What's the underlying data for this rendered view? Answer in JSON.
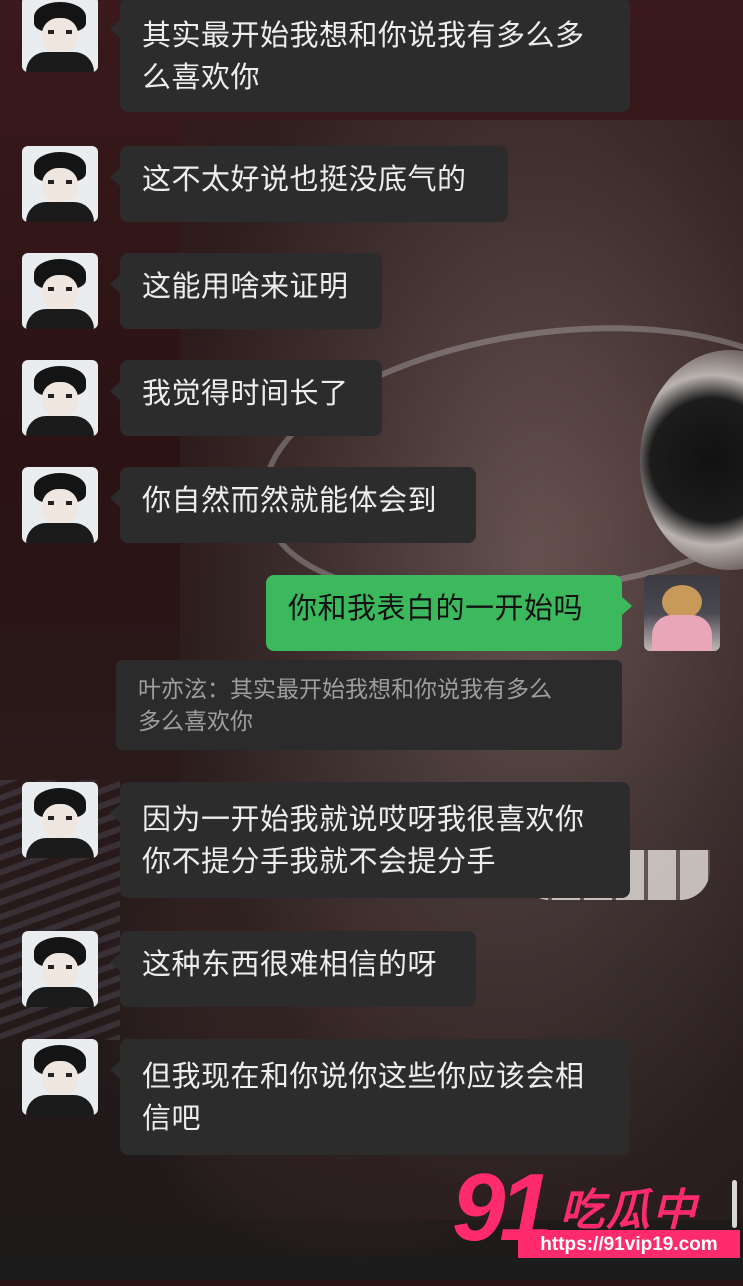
{
  "messages": [
    {
      "side": "left",
      "text": "其实最开始我想和你说我有多么多么喜欢你",
      "line1": "其实最开始我想和你说我有多么多",
      "line2": "么喜欢你"
    },
    {
      "side": "left",
      "text": "这不太好说也挺没底气的"
    },
    {
      "side": "left",
      "text": "这能用啥来证明"
    },
    {
      "side": "left",
      "text": "我觉得时间长了"
    },
    {
      "side": "left",
      "text": "你自然而然就能体会到"
    },
    {
      "side": "right",
      "text": "你和我表白的一开始吗"
    },
    {
      "side": "left",
      "text": "因为一开始我就说哎呀我很喜欢你你不提分手我就不会提分手",
      "line1": "因为一开始我就说哎呀我很喜欢你",
      "line2": "你不提分手我就不会提分手"
    },
    {
      "side": "left",
      "text": "这种东西很难相信的呀"
    },
    {
      "side": "left",
      "text": "但我现在和你说你这些你应该会相信吧",
      "line1": "但我现在和你说你这些你应该会相",
      "line2": "信吧"
    }
  ],
  "quote": {
    "line1": "叶亦泫：其实最开始我想和你说我有多么",
    "line2": "多么喜欢你"
  },
  "watermark": {
    "number": "91",
    "brand": "吃瓜中心",
    "url": "https://91vip19.com"
  },
  "colors": {
    "bubble_other": "#2c2c2c",
    "bubble_self": "#3cb95d",
    "watermark": "#ff2b6d"
  },
  "icons": {
    "other_avatar": "anime-boy-avatar",
    "self_avatar": "girl-with-dog-avatar"
  }
}
